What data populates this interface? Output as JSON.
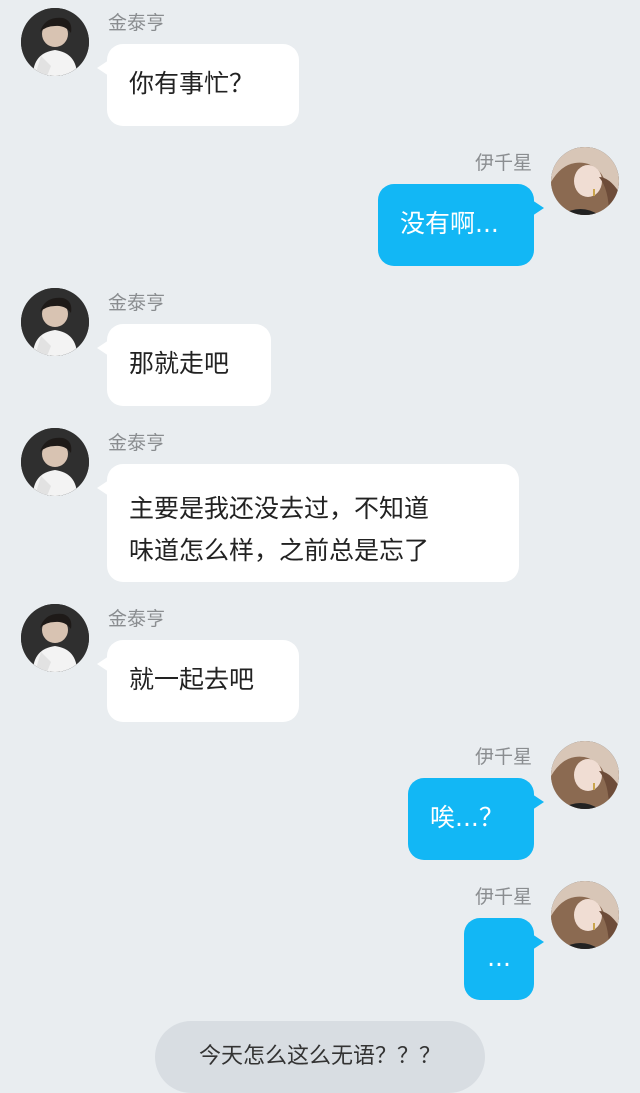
{
  "contacts": {
    "left_name": "金泰亨",
    "right_name": "伊千星"
  },
  "messages": [
    {
      "side": "left",
      "sender": "金泰亨",
      "text": "你有事忙？"
    },
    {
      "side": "right",
      "sender": "伊千星",
      "text": "没有啊..."
    },
    {
      "side": "left",
      "sender": "金泰亨",
      "text": "那就走吧"
    },
    {
      "side": "left",
      "sender": "金泰亨",
      "text_lines": [
        "主要是我还没去过，不知道",
        "味道怎么样，之前总是忘了"
      ]
    },
    {
      "side": "left",
      "sender": "金泰亨",
      "text": "就一起去吧"
    },
    {
      "side": "right",
      "sender": "伊千星",
      "text": "唉...？"
    },
    {
      "side": "right",
      "sender": "伊千星",
      "text": "..."
    }
  ],
  "footer": {
    "text": "今天怎么这么无语？？？"
  },
  "colors": {
    "background": "#e9edf0",
    "left_bubble": "#ffffff",
    "right_bubble": "#12b7f5",
    "sender_name": "#8a8d90",
    "system_bar": "#d8dde2"
  },
  "icons": {
    "left_avatar": "avatar-male-icon",
    "right_avatar": "avatar-female-icon"
  }
}
